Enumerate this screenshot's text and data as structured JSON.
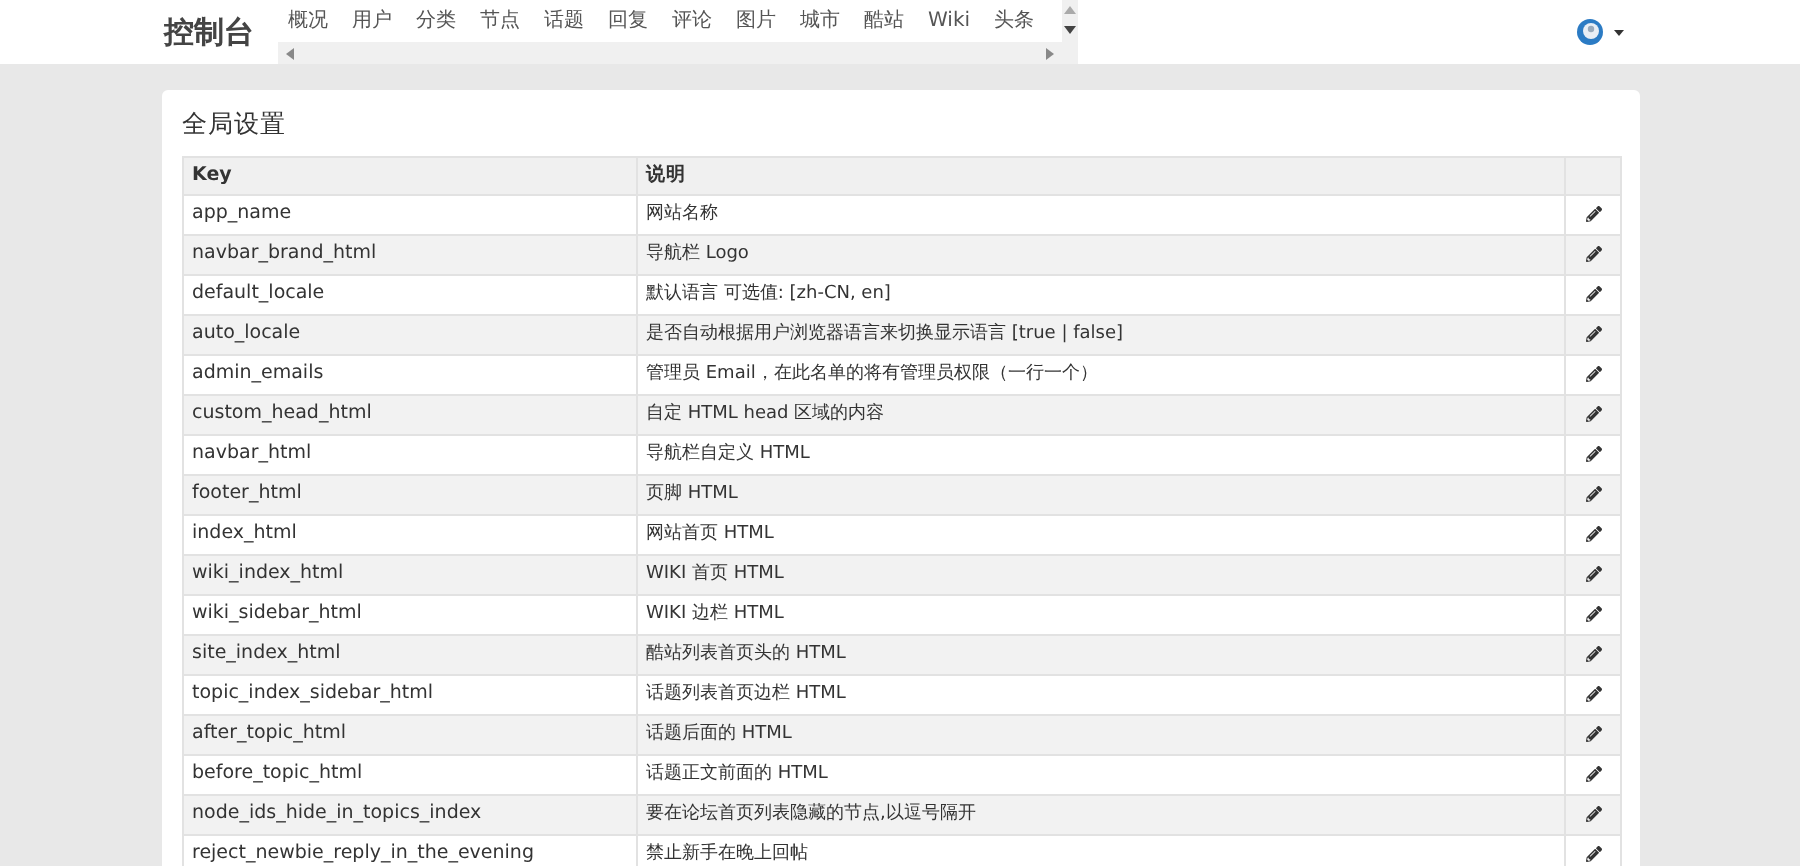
{
  "navbar": {
    "brand": "控制台",
    "links": [
      {
        "label": "概况"
      },
      {
        "label": "用户"
      },
      {
        "label": "分类"
      },
      {
        "label": "节点"
      },
      {
        "label": "话题"
      },
      {
        "label": "回复"
      },
      {
        "label": "评论"
      },
      {
        "label": "图片"
      },
      {
        "label": "城市"
      },
      {
        "label": "酷站"
      },
      {
        "label": "Wiki"
      },
      {
        "label": "头条"
      }
    ]
  },
  "panel": {
    "title": "全局设置",
    "table": {
      "columns": [
        "Key",
        "说明"
      ],
      "rows": [
        {
          "key": "app_name",
          "description": "网站名称"
        },
        {
          "key": "navbar_brand_html",
          "description": "导航栏 Logo"
        },
        {
          "key": "default_locale",
          "description": "默认语言 可选值: [zh-CN, en]"
        },
        {
          "key": "auto_locale",
          "description": "是否自动根据用户浏览器语言来切换显示语言 [true | false]"
        },
        {
          "key": "admin_emails",
          "description": "管理员 Email，在此名单的将有管理员权限（一行一个）"
        },
        {
          "key": "custom_head_html",
          "description": "自定 HTML head 区域的内容"
        },
        {
          "key": "navbar_html",
          "description": "导航栏自定义 HTML"
        },
        {
          "key": "footer_html",
          "description": "页脚 HTML"
        },
        {
          "key": "index_html",
          "description": "网站首页 HTML"
        },
        {
          "key": "wiki_index_html",
          "description": "WIKI 首页 HTML"
        },
        {
          "key": "wiki_sidebar_html",
          "description": "WIKI 边栏 HTML"
        },
        {
          "key": "site_index_html",
          "description": "酷站列表首页头的 HTML"
        },
        {
          "key": "topic_index_sidebar_html",
          "description": "话题列表首页边栏 HTML"
        },
        {
          "key": "after_topic_html",
          "description": "话题后面的 HTML"
        },
        {
          "key": "before_topic_html",
          "description": "话题正文前面的 HTML"
        },
        {
          "key": "node_ids_hide_in_topics_index",
          "description": "要在论坛首页列表隐藏的节点,以逗号隔开"
        },
        {
          "key": "reject_newbie_reply_in_the_evening",
          "description": "禁止新手在晚上回帖"
        }
      ]
    }
  }
}
